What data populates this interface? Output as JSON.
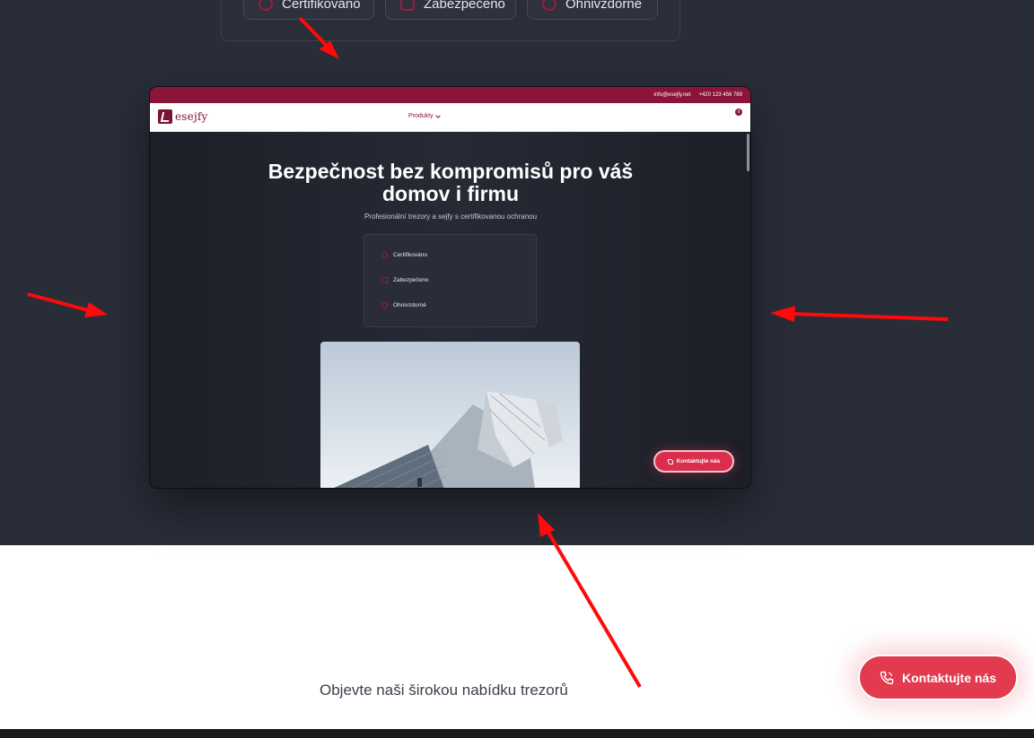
{
  "top_panel": {
    "badges": [
      {
        "label": "Certifikováno",
        "icon": "shield-icon"
      },
      {
        "label": "Zabezpečeno",
        "icon": "lock-icon"
      },
      {
        "label": "Ohnivzdorné",
        "icon": "flame-icon"
      }
    ]
  },
  "preview": {
    "topbar": {
      "email": "info@esejfy.net",
      "phone": "+420 123 456 789"
    },
    "logo": "esejfy",
    "nav_menu": "Produkty",
    "cart_count": "0",
    "hero_title": "Bezpečnost bez kompromisů pro váš domov i firmu",
    "hero_subtitle": "Profesionální trezory a sejfy s certifikovanou ochranou",
    "features": [
      {
        "label": "Certifikováno",
        "icon": "shield-icon"
      },
      {
        "label": "Zabezpečeno",
        "icon": "lock-icon"
      },
      {
        "label": "Ohnivzdorné",
        "icon": "flame-icon"
      }
    ],
    "cta_label": "Kontaktujte nás"
  },
  "tagline": "Objevte naši širokou nabídku trezorů",
  "floating_cta": {
    "label": "Kontaktujte nás",
    "icon": "phone-icon"
  },
  "colors": {
    "brand": "#8a1538",
    "cta": "#e23a4f",
    "dark_bg": "#292d38",
    "arrow": "#ff0000"
  }
}
